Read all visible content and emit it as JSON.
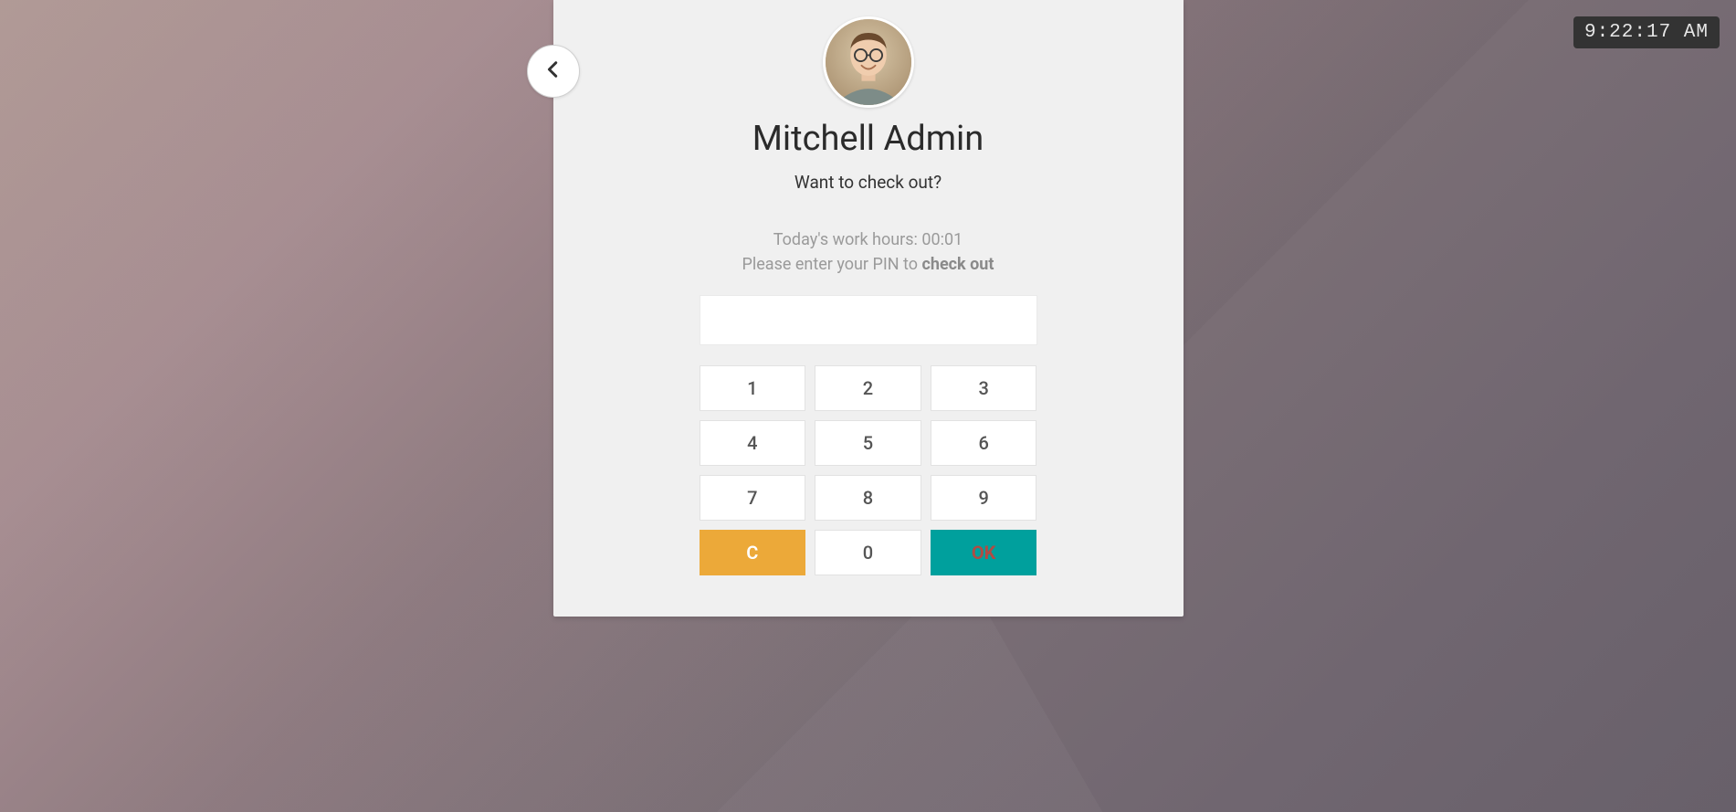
{
  "clock": "9:22:17 AM",
  "employee": {
    "name": "Mitchell Admin",
    "prompt": "Want to check out?",
    "hours_label": "Today's work hours: 00:01",
    "pin_prompt_prefix": "Please enter your PIN to ",
    "pin_prompt_bold": "check out"
  },
  "pin_value": "",
  "keypad": {
    "k1": "1",
    "k2": "2",
    "k3": "3",
    "k4": "4",
    "k5": "5",
    "k6": "6",
    "k7": "7",
    "k8": "8",
    "k9": "9",
    "clear": "C",
    "k0": "0",
    "ok": "OK"
  }
}
